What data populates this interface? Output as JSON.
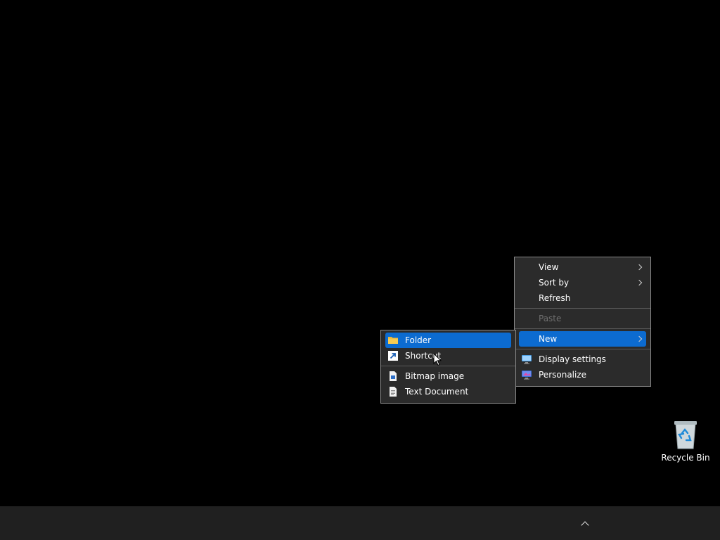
{
  "context_menu": {
    "items": [
      {
        "label": "View",
        "has_submenu": true,
        "enabled": true
      },
      {
        "label": "Sort by",
        "has_submenu": true,
        "enabled": true
      },
      {
        "label": "Refresh",
        "has_submenu": false,
        "enabled": true
      },
      {
        "label": "Paste",
        "has_submenu": false,
        "enabled": false
      },
      {
        "label": "New",
        "has_submenu": true,
        "enabled": true,
        "highlighted": true
      },
      {
        "label": "Display settings",
        "icon": "display-settings-icon",
        "enabled": true
      },
      {
        "label": "Personalize",
        "icon": "personalize-icon",
        "enabled": true
      }
    ]
  },
  "new_submenu": {
    "items": [
      {
        "label": "Folder",
        "icon": "folder-icon",
        "highlighted": true
      },
      {
        "label": "Shortcut",
        "icon": "shortcut-icon"
      },
      {
        "label": "Bitmap image",
        "icon": "bitmap-image-icon"
      },
      {
        "label": "Text Document",
        "icon": "text-document-icon"
      }
    ]
  },
  "desktop_icons": [
    {
      "label": "Recycle Bin",
      "icon": "recycle-bin-icon"
    }
  ],
  "taskbar": {
    "tray_overflow_icon": "chevron-up-icon"
  },
  "colors": {
    "desktop_background": "#000000",
    "menu_background": "#2b2b2b",
    "highlight": "#0c6bd0",
    "taskbar": "#202020",
    "disabled_text": "#6f6f6f"
  }
}
